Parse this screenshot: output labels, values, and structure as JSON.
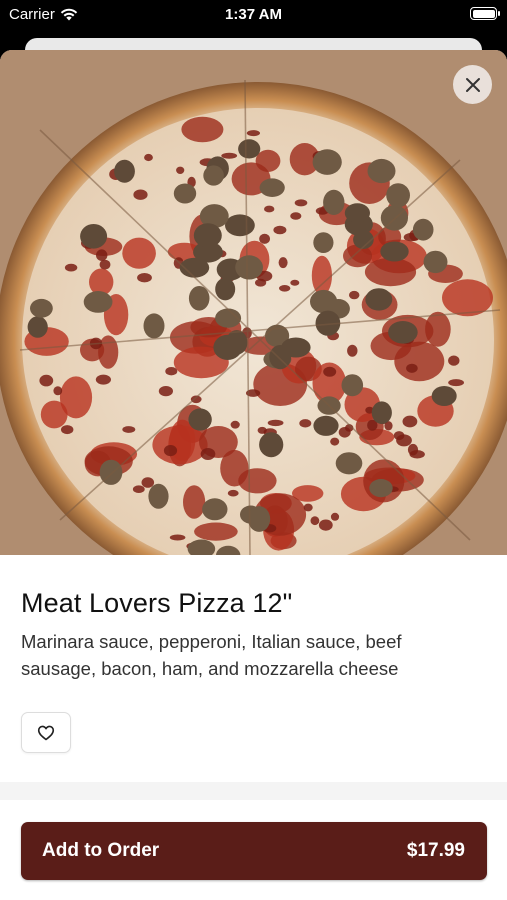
{
  "status_bar": {
    "carrier": "Carrier",
    "time": "1:37 AM"
  },
  "item": {
    "name": "Meat Lovers Pizza 12\"",
    "description": "Marinara sauce, pepperoni, Italian sauce, beef sausage, bacon, ham, and mozzarella cheese",
    "image": "pizza-photo"
  },
  "actions": {
    "close_icon": "close-icon",
    "favorite_icon": "heart-icon",
    "add_label": "Add to Order",
    "price": "$17.99"
  },
  "colors": {
    "accent": "#5a1d18",
    "text": "#111111"
  }
}
